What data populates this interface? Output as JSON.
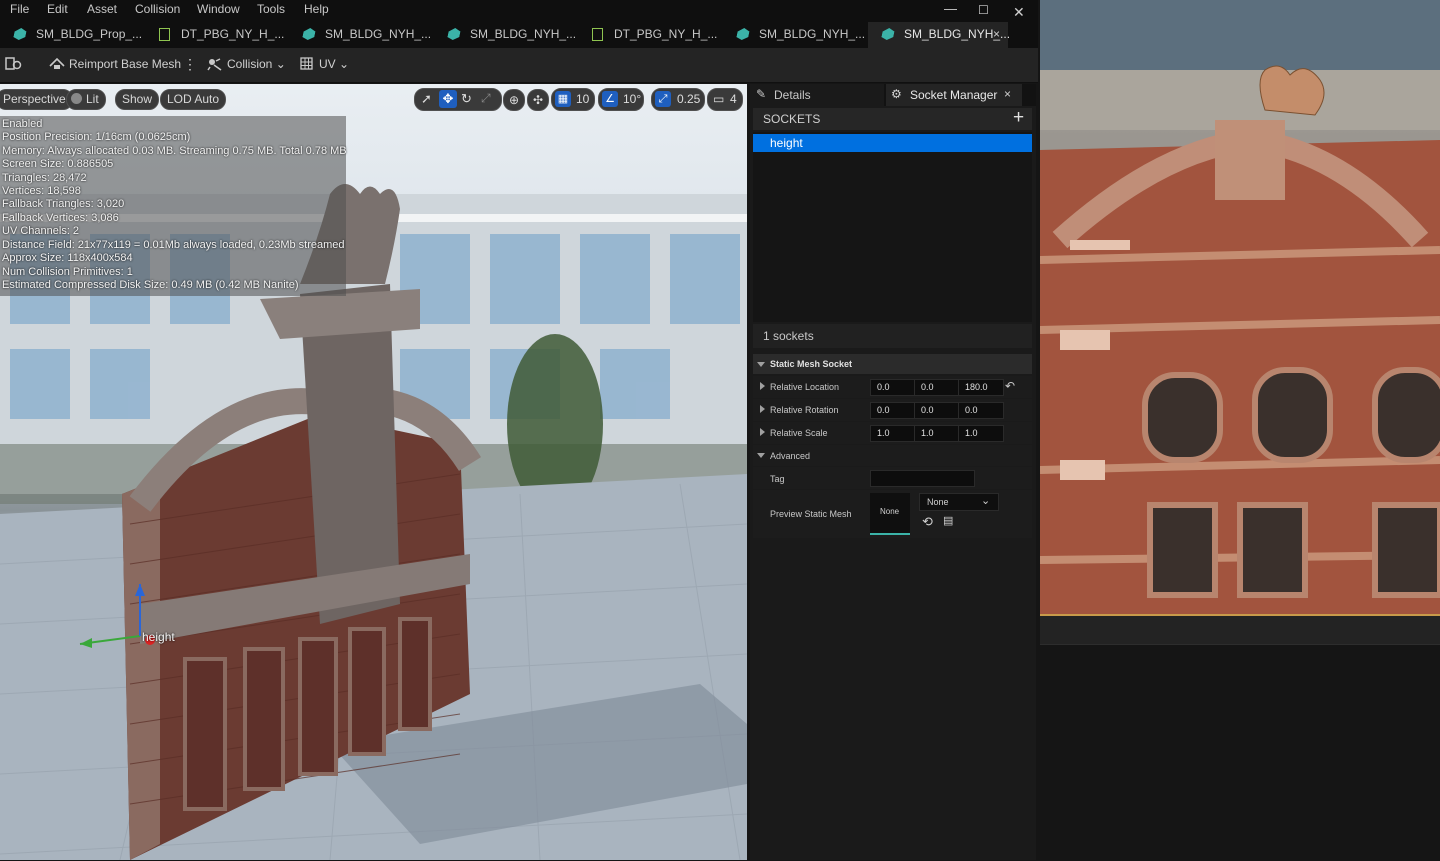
{
  "menu": {
    "items": [
      "File",
      "Edit",
      "Asset",
      "Collision",
      "Window",
      "Tools",
      "Help"
    ]
  },
  "window_controls": {
    "minimize": "—",
    "maximize": "☐",
    "close": "✕"
  },
  "tabs": [
    {
      "label": "SM_BLDG_Prop_...",
      "icon": "static-mesh-icon"
    },
    {
      "label": "DT_PBG_NY_H_...",
      "icon": "data-table-icon"
    },
    {
      "label": "SM_BLDG_NYH_...",
      "icon": "static-mesh-icon"
    },
    {
      "label": "SM_BLDG_NYH_...",
      "icon": "static-mesh-icon"
    },
    {
      "label": "DT_PBG_NY_H_...",
      "icon": "data-table-icon"
    },
    {
      "label": "SM_BLDG_NYH_...",
      "icon": "static-mesh-icon"
    },
    {
      "label": "SM_BLDG_NYH_...",
      "icon": "static-mesh-icon",
      "active": true,
      "close": "×"
    }
  ],
  "toolbar": {
    "reimport": "Reimport Base Mesh",
    "more": "⋮",
    "collision": "Collision",
    "uv": "UV"
  },
  "viewport": {
    "perspective": "Perspective",
    "lit": "Lit",
    "show": "Show",
    "lod": "LOD Auto",
    "grid_snap": "10",
    "rotation_snap": "10°",
    "scale_snap": "0.25",
    "camera_speed": "4",
    "socket_label": "height",
    "stats": [
      "Enabled",
      "Position Precision: 1/16cm (0.0625cm)",
      "Memory: Always allocated 0.03 MB. Streaming 0.75 MB. Total 0.78 MB",
      "Screen Size: 0.886505",
      "Triangles: 28,472",
      "Vertices: 18,598",
      "Fallback Triangles: 3,020",
      "Fallback Vertices: 3,086",
      "UV Channels: 2",
      "Distance Field: 21x77x119 = 0.01Mb always loaded, 0.23Mb streamed",
      "Approx Size: 118x400x584",
      "Num Collision Primitives: 1",
      "Estimated Compressed Disk Size: 0.49 MB (0.42 MB Nanite)"
    ]
  },
  "details": {
    "tab_details": "Details",
    "tab_socket_manager": "Socket Manager",
    "close": "×",
    "sockets_header": "SOCKETS",
    "add": "+",
    "socket_items": [
      "height"
    ],
    "socket_count": "1 sockets",
    "section": "Static Mesh Socket",
    "relative_location": {
      "label": "Relative Location",
      "x": "0.0",
      "y": "0.0",
      "z": "180.0"
    },
    "relative_rotation": {
      "label": "Relative Rotation",
      "x": "0.0",
      "y": "0.0",
      "z": "0.0"
    },
    "relative_scale": {
      "label": "Relative Scale",
      "x": "1.0",
      "y": "1.0",
      "z": "1.0"
    },
    "advanced": "Advanced",
    "tag_label": "Tag",
    "tag_value": "",
    "preview_mesh_label": "Preview Static Mesh",
    "preview_thumb": "None",
    "preview_dropdown": "None"
  },
  "colors": {
    "accent": "#0070e0",
    "selected_row": "#0070e0",
    "teal": "#3bb3a8",
    "preview_border": "#c89a4a"
  }
}
